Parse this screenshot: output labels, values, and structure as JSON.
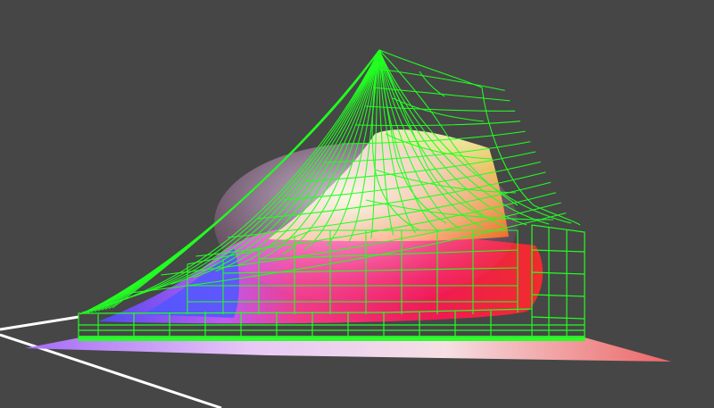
{
  "scene": {
    "background_color": "#464646",
    "wireframe_color": "#22ff22",
    "axis_line_color": "#ffffff",
    "solid_gamut_colors": [
      "#ffffff",
      "#ff2a78",
      "#ff1a4a",
      "#ff7a00",
      "#f4f07a",
      "#5a6cff",
      "#d35cff"
    ],
    "floor_gradient_colors": [
      "#b07bff",
      "#ffffff",
      "#ff7b7b"
    ]
  }
}
